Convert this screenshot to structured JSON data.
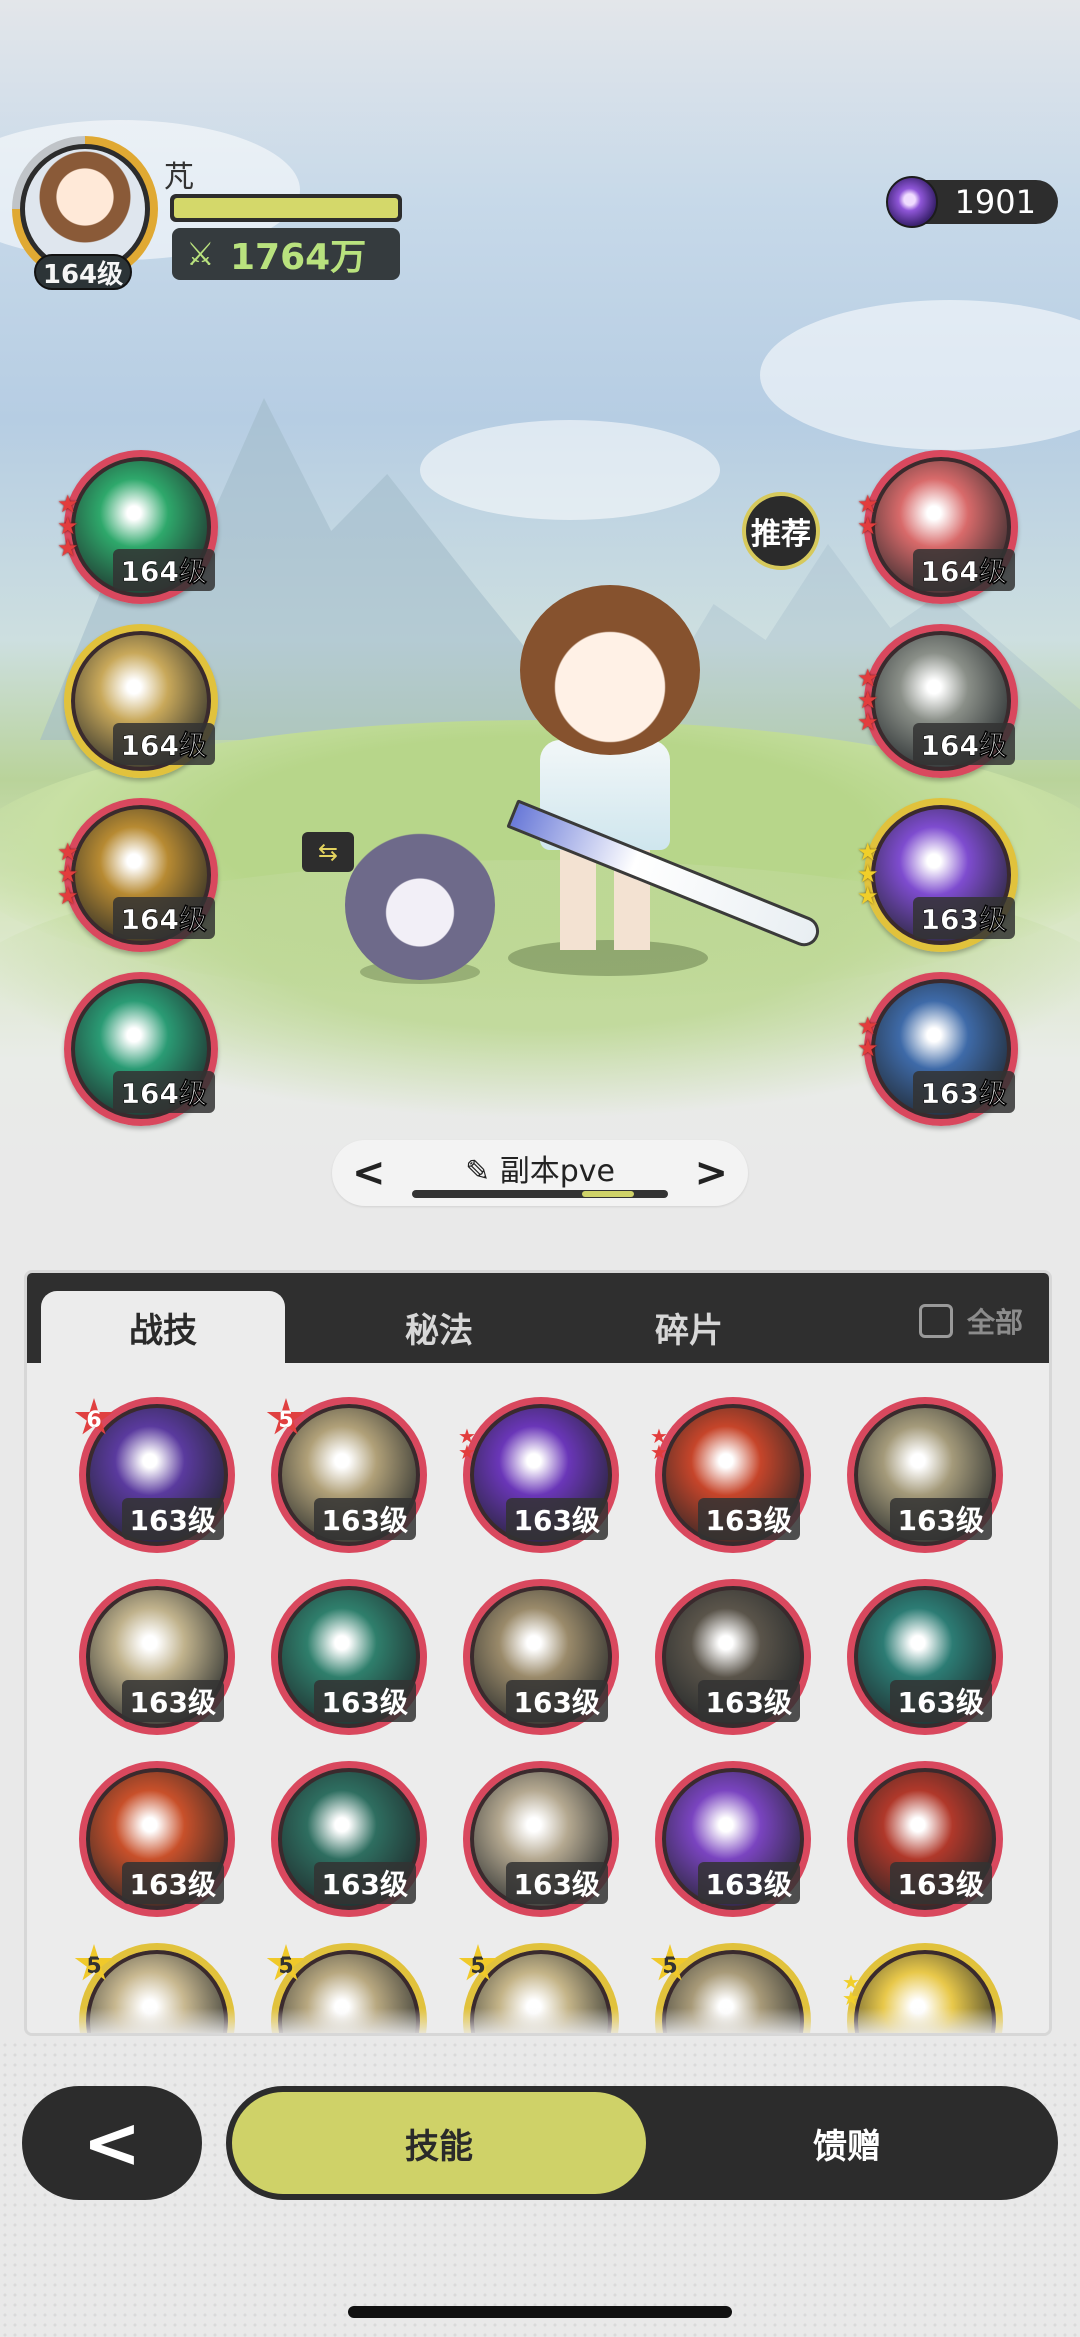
{
  "player": {
    "name": "芃",
    "level": "164级",
    "power": "1764万",
    "hp_fraction": 1.0
  },
  "currency": {
    "amount": "1901",
    "icon": "purple-crystal-icon"
  },
  "recommend_label": "推荐",
  "equipped_left": [
    {
      "level": "164级",
      "stars": 3,
      "star_color": "red",
      "icon": "green-arrows-skill-icon",
      "color": "#2ea86b"
    },
    {
      "level": "164级",
      "stars": 0,
      "star_color": "none",
      "icon": "gold-starburst-skill-icon",
      "color": "#c8a85a",
      "ring": "gold"
    },
    {
      "level": "164级",
      "stars": 3,
      "star_color": "red",
      "icon": "golden-wave-skill-icon",
      "color": "#b78a32"
    },
    {
      "level": "164级",
      "stars": 0,
      "star_color": "none",
      "icon": "green-swirl-skill-icon",
      "color": "#2a9b74"
    }
  ],
  "equipped_right": [
    {
      "level": "164级",
      "stars": 2,
      "star_color": "red",
      "icon": "red-sword-skill-icon",
      "color": "#d86a6a"
    },
    {
      "level": "164级",
      "stars": 3,
      "star_color": "red",
      "icon": "gray-fist-skill-icon",
      "color": "#8a8f88"
    },
    {
      "level": "163级",
      "stars": 3,
      "star_color": "yellow",
      "icon": "purple-orb-skill-icon",
      "color": "#7e4ccf",
      "ring": "gold"
    },
    {
      "level": "163级",
      "stars": 2,
      "star_color": "red",
      "icon": "blue-crystal-skill-icon",
      "color": "#3e6aa8"
    }
  ],
  "preset": {
    "name": "副本pve",
    "prev_icon": "chevron-left-icon",
    "next_icon": "chevron-right-icon",
    "page_fraction": 0.5
  },
  "tabs": [
    {
      "label": "战技",
      "active": true
    },
    {
      "label": "秘法",
      "active": false
    },
    {
      "label": "碎片",
      "active": false
    }
  ],
  "all_toggle_label": "全部",
  "skills": [
    {
      "level": "163级",
      "badge": "6",
      "badge_color": "red",
      "color": "#5a3a9e"
    },
    {
      "level": "163级",
      "badge": "5",
      "badge_color": "red",
      "color": "#b0a078"
    },
    {
      "level": "163级",
      "stars": 2,
      "color": "#6a36b8"
    },
    {
      "level": "163级",
      "stars": 2,
      "color": "#c6452a"
    },
    {
      "level": "163级",
      "color": "#a49a7a"
    },
    {
      "level": "163级",
      "color": "#c0b28c"
    },
    {
      "level": "163级",
      "color": "#2f7f6c"
    },
    {
      "level": "163级",
      "color": "#9a8a6a"
    },
    {
      "level": "163级",
      "color": "#5a544a"
    },
    {
      "level": "163级",
      "color": "#2c7c74"
    },
    {
      "level": "163级",
      "color": "#c8502a"
    },
    {
      "level": "163级",
      "color": "#2e6e60"
    },
    {
      "level": "163级",
      "color": "#b4a890"
    },
    {
      "level": "163级",
      "color": "#7a44c0"
    },
    {
      "level": "163级",
      "color": "#b0382a"
    },
    {
      "level": "",
      "badge": "5",
      "badge_color": "yellow",
      "color": "#c8b890",
      "ring": "gold"
    },
    {
      "level": "",
      "badge": "5",
      "badge_color": "yellow",
      "color": "#b8a880",
      "ring": "gold"
    },
    {
      "level": "",
      "badge": "5",
      "badge_color": "yellow",
      "color": "#c4b488",
      "ring": "gold"
    },
    {
      "level": "",
      "badge": "5",
      "badge_color": "yellow",
      "color": "#a89a78",
      "ring": "gold"
    },
    {
      "level": "",
      "stars": 2,
      "star_color": "yellow",
      "color": "#e8c84a",
      "ring": "gold"
    }
  ],
  "bottom_nav": {
    "back_icon": "chevron-left-icon",
    "tabs": [
      {
        "label": "技能",
        "active": true
      },
      {
        "label": "馈赠",
        "active": false
      }
    ]
  }
}
